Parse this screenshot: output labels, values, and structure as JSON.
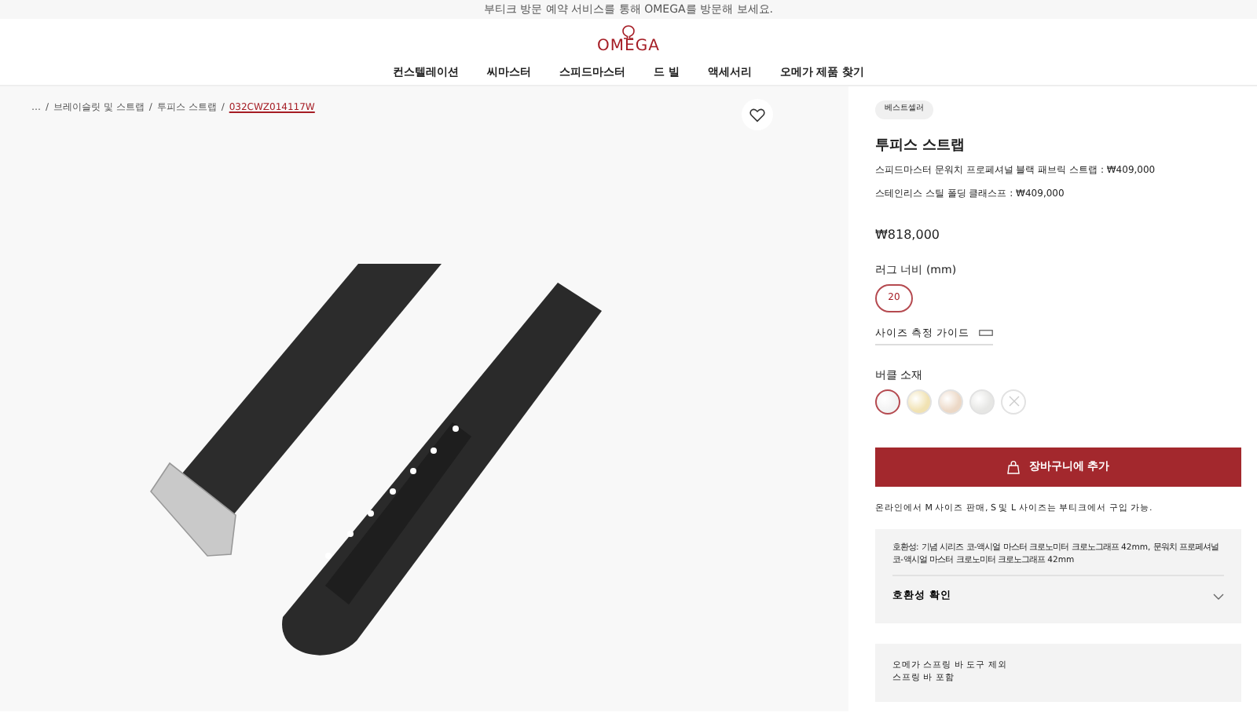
{
  "banner": {
    "link": "부티크 방문 예약 서비스",
    "text": "를 통해 OMEGA를 방문해 보세요."
  },
  "logo": {
    "text": "OMEGA"
  },
  "nav": [
    "컨스텔레이션",
    "씨마스터",
    "스피드마스터",
    "드 빌",
    "액세서리",
    "오메가 제품 찾기"
  ],
  "breadcrumb": [
    {
      "kind": "link",
      "label": "…",
      "current": false
    },
    {
      "kind": "separator",
      "label": "/"
    },
    {
      "kind": "link",
      "label": "브레이슬릿 및 스트랩",
      "current": false
    },
    {
      "kind": "separator",
      "label": "/"
    },
    {
      "kind": "link",
      "label": "투피스 스트랩",
      "current": false
    },
    {
      "kind": "separator",
      "label": "/"
    },
    {
      "kind": "link",
      "label": "032CWZ014117W",
      "current": true
    }
  ],
  "product": {
    "badge": "베스트셀러",
    "title": "투피스 스트랩",
    "components": [
      "스피드마스터 문워치 프로페셔널 블랙 패브릭 스트랩 : ₩409,000",
      "스테인리스 스틸 폴딩 클래스프 : ₩409,000"
    ],
    "price": "₩818,000",
    "lug_label": "러그 너비 (mm)",
    "lug_sizes": [
      {
        "label": "20",
        "selected": true
      }
    ],
    "size_guide": "사이즈 측정 가이드",
    "buckle_label": "버클 소재",
    "buckles": [
      {
        "color": "#f2f2f2",
        "selected": true,
        "disabled": false
      },
      {
        "color": "#f1e2b2",
        "selected": false,
        "disabled": false
      },
      {
        "color": "#ecd8c6",
        "selected": false,
        "disabled": false
      },
      {
        "color": "#e6e6e4",
        "selected": false,
        "disabled": false
      },
      {
        "color": "#ffffff",
        "selected": false,
        "disabled": true
      }
    ],
    "add_button": "장바구니에 추가",
    "availability": "온라인에서 M 사이즈 판매, S 및 L 사이즈는 부티크에서 구입 가능.",
    "compat_text": "호환성: 기념 시리즈 코-액시얼 마스터 크로노미터 크로노그래프 42mm, 문워치 프로페셔널 코-액시얼 마스터 크로노미터 크로노그래프 42mm",
    "compat_toggle": {
      "label": "호환성 확인",
      "expanded": false
    },
    "notes": [
      "오메가 스프링 바 도구 제외",
      "스프링 바 포함"
    ]
  }
}
